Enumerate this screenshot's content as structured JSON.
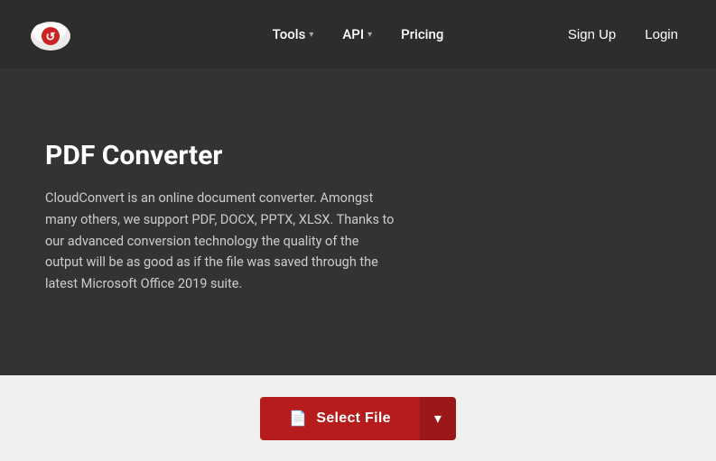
{
  "navbar": {
    "logo_alt": "CloudConvert Logo",
    "links": [
      {
        "label": "Tools",
        "has_dropdown": true
      },
      {
        "label": "API",
        "has_dropdown": true
      },
      {
        "label": "Pricing",
        "has_dropdown": false
      }
    ],
    "auth": {
      "signup": "Sign Up",
      "login": "Login"
    }
  },
  "hero": {
    "title": "PDF Converter",
    "description": "CloudConvert is an online document converter. Amongst many others, we support PDF, DOCX, PPTX, XLSX. Thanks to our advanced conversion technology the quality of the output will be as good as if the file was saved through the latest Microsoft Office 2019 suite."
  },
  "cta": {
    "select_file_label": "Select File",
    "dropdown_label": "▾"
  },
  "colors": {
    "navbar_bg": "#2d2d2d",
    "hero_bg": "#333333",
    "bottom_bg": "#f0f0f0",
    "btn_primary": "#b71c1c",
    "btn_dropdown": "#9b1818"
  }
}
